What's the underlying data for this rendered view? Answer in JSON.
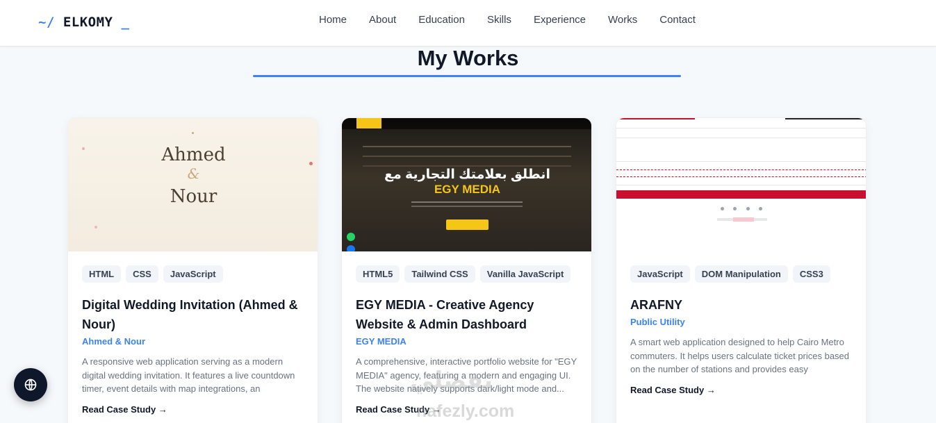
{
  "brand": {
    "prefix": "~/",
    "name": "ELKOMY",
    "cursor": "_"
  },
  "nav": {
    "items": [
      "Home",
      "About",
      "Education",
      "Skills",
      "Experience",
      "Works",
      "Contact"
    ]
  },
  "section": {
    "title": "My Works",
    "accent_color": "#3b82f6"
  },
  "projects": [
    {
      "tags": [
        "HTML",
        "CSS",
        "JavaScript"
      ],
      "title": "Digital Wedding Invitation (Ahmed & Nour)",
      "client": "Ahmed & Nour",
      "description": "A responsive web application serving as a modern digital wedding invitation. It features a live countdown timer, event details with map integrations, an interactiv...",
      "link": "Read Case Study →",
      "thumb": {
        "name1": "Ahmed",
        "amp": "&",
        "name2": "Nour"
      }
    },
    {
      "tags": [
        "HTML5",
        "Tailwind CSS",
        "Vanilla JavaScript"
      ],
      "title": "EGY MEDIA - Creative Agency Website & Admin Dashboard",
      "client": "EGY MEDIA",
      "description": "A comprehensive, interactive portfolio website for \"EGY MEDIA\" agency, featuring a modern and engaging UI. The website natively supports dark/light mode and...",
      "link": "Read Case Study →",
      "thumb": {
        "headline": "انطلق بعلامتك التجارية مع",
        "brand": "EGY MEDIA"
      }
    },
    {
      "tags": [
        "JavaScript",
        "DOM Manipulation",
        "CSS3"
      ],
      "title": "ARAFNY",
      "client": "Public Utility",
      "description": "A smart web application designed to help Cairo Metro commuters. It helps users calculate ticket prices based on the number of stations and provides easy navigatio... through the metro lines.",
      "link": "Read Case Study →"
    }
  ],
  "language_button": {
    "icon": "globe-icon"
  },
  "watermark": {
    "arabic": "نفضلي",
    "text": "nafezly.com"
  }
}
